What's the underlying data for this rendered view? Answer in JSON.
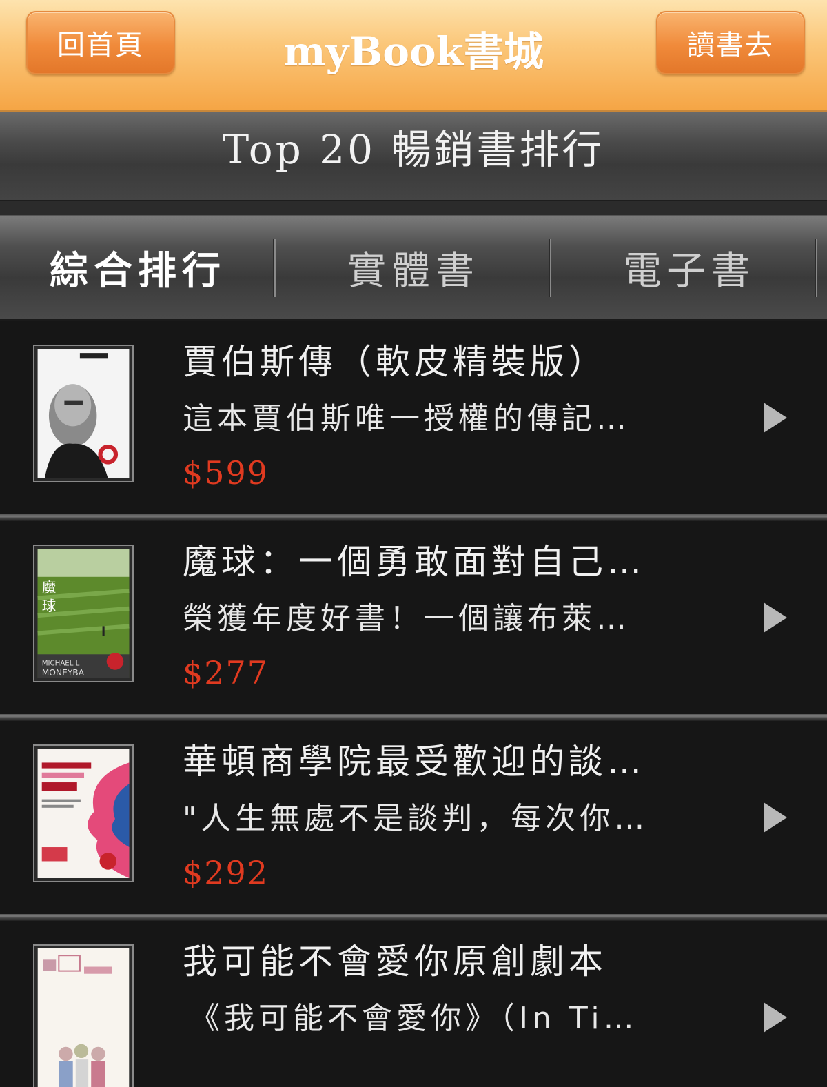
{
  "header": {
    "home_button": "回首頁",
    "title": "myBook書城",
    "read_button": "讀書去"
  },
  "page_title": "Top 20 暢銷書排行",
  "tabs": [
    {
      "label": "綜合排行",
      "active": true
    },
    {
      "label": "實體書",
      "active": false
    },
    {
      "label": "電子書",
      "active": false
    }
  ],
  "books": [
    {
      "title": "賈伯斯傳（軟皮精裝版）",
      "description": "這本賈伯斯唯一授權的傳記…",
      "price": "$599",
      "cover_icon": "steve-jobs-cover"
    },
    {
      "title": "魔球：一個勇敢面對自己…",
      "description": "榮獲年度好書！一個讓布萊…",
      "price": "$277",
      "cover_icon": "moneyball-cover"
    },
    {
      "title": "華頓商學院最受歡迎的談…",
      "description": "\"人生無處不是談判，每次你…",
      "price": "$292",
      "cover_icon": "negotiation-cover"
    },
    {
      "title": "我可能不會愛你原創劇本",
      "description": "《我可能不會愛你》（In Ti…",
      "price": "",
      "cover_icon": "drama-script-cover"
    }
  ],
  "colors": {
    "header_orange": "#f5a545",
    "price_red": "#e03a20",
    "list_bg": "#151515"
  }
}
